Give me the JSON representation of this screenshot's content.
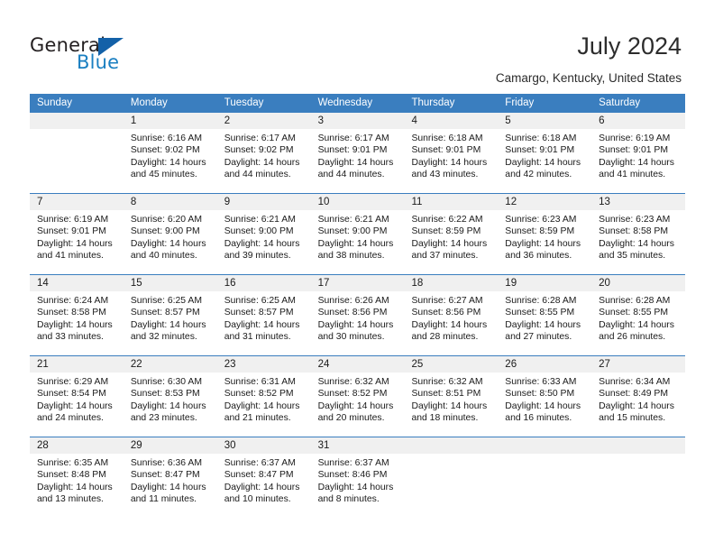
{
  "brand": {
    "name_top": "General",
    "name_bottom": "Blue",
    "triangle_color": "#1361a8",
    "blue_color": "#1a7fc1"
  },
  "header": {
    "title": "July 2024",
    "subtitle": "Camargo, Kentucky, United States",
    "header_bar_color": "#3a7ebf"
  },
  "weekdays": [
    "Sunday",
    "Monday",
    "Tuesday",
    "Wednesday",
    "Thursday",
    "Friday",
    "Saturday"
  ],
  "weeks": [
    [
      {
        "day": "",
        "lines": []
      },
      {
        "day": "1",
        "lines": [
          "Sunrise: 6:16 AM",
          "Sunset: 9:02 PM",
          "Daylight: 14 hours",
          "and 45 minutes."
        ]
      },
      {
        "day": "2",
        "lines": [
          "Sunrise: 6:17 AM",
          "Sunset: 9:02 PM",
          "Daylight: 14 hours",
          "and 44 minutes."
        ]
      },
      {
        "day": "3",
        "lines": [
          "Sunrise: 6:17 AM",
          "Sunset: 9:01 PM",
          "Daylight: 14 hours",
          "and 44 minutes."
        ]
      },
      {
        "day": "4",
        "lines": [
          "Sunrise: 6:18 AM",
          "Sunset: 9:01 PM",
          "Daylight: 14 hours",
          "and 43 minutes."
        ]
      },
      {
        "day": "5",
        "lines": [
          "Sunrise: 6:18 AM",
          "Sunset: 9:01 PM",
          "Daylight: 14 hours",
          "and 42 minutes."
        ]
      },
      {
        "day": "6",
        "lines": [
          "Sunrise: 6:19 AM",
          "Sunset: 9:01 PM",
          "Daylight: 14 hours",
          "and 41 minutes."
        ]
      }
    ],
    [
      {
        "day": "7",
        "lines": [
          "Sunrise: 6:19 AM",
          "Sunset: 9:01 PM",
          "Daylight: 14 hours",
          "and 41 minutes."
        ]
      },
      {
        "day": "8",
        "lines": [
          "Sunrise: 6:20 AM",
          "Sunset: 9:00 PM",
          "Daylight: 14 hours",
          "and 40 minutes."
        ]
      },
      {
        "day": "9",
        "lines": [
          "Sunrise: 6:21 AM",
          "Sunset: 9:00 PM",
          "Daylight: 14 hours",
          "and 39 minutes."
        ]
      },
      {
        "day": "10",
        "lines": [
          "Sunrise: 6:21 AM",
          "Sunset: 9:00 PM",
          "Daylight: 14 hours",
          "and 38 minutes."
        ]
      },
      {
        "day": "11",
        "lines": [
          "Sunrise: 6:22 AM",
          "Sunset: 8:59 PM",
          "Daylight: 14 hours",
          "and 37 minutes."
        ]
      },
      {
        "day": "12",
        "lines": [
          "Sunrise: 6:23 AM",
          "Sunset: 8:59 PM",
          "Daylight: 14 hours",
          "and 36 minutes."
        ]
      },
      {
        "day": "13",
        "lines": [
          "Sunrise: 6:23 AM",
          "Sunset: 8:58 PM",
          "Daylight: 14 hours",
          "and 35 minutes."
        ]
      }
    ],
    [
      {
        "day": "14",
        "lines": [
          "Sunrise: 6:24 AM",
          "Sunset: 8:58 PM",
          "Daylight: 14 hours",
          "and 33 minutes."
        ]
      },
      {
        "day": "15",
        "lines": [
          "Sunrise: 6:25 AM",
          "Sunset: 8:57 PM",
          "Daylight: 14 hours",
          "and 32 minutes."
        ]
      },
      {
        "day": "16",
        "lines": [
          "Sunrise: 6:25 AM",
          "Sunset: 8:57 PM",
          "Daylight: 14 hours",
          "and 31 minutes."
        ]
      },
      {
        "day": "17",
        "lines": [
          "Sunrise: 6:26 AM",
          "Sunset: 8:56 PM",
          "Daylight: 14 hours",
          "and 30 minutes."
        ]
      },
      {
        "day": "18",
        "lines": [
          "Sunrise: 6:27 AM",
          "Sunset: 8:56 PM",
          "Daylight: 14 hours",
          "and 28 minutes."
        ]
      },
      {
        "day": "19",
        "lines": [
          "Sunrise: 6:28 AM",
          "Sunset: 8:55 PM",
          "Daylight: 14 hours",
          "and 27 minutes."
        ]
      },
      {
        "day": "20",
        "lines": [
          "Sunrise: 6:28 AM",
          "Sunset: 8:55 PM",
          "Daylight: 14 hours",
          "and 26 minutes."
        ]
      }
    ],
    [
      {
        "day": "21",
        "lines": [
          "Sunrise: 6:29 AM",
          "Sunset: 8:54 PM",
          "Daylight: 14 hours",
          "and 24 minutes."
        ]
      },
      {
        "day": "22",
        "lines": [
          "Sunrise: 6:30 AM",
          "Sunset: 8:53 PM",
          "Daylight: 14 hours",
          "and 23 minutes."
        ]
      },
      {
        "day": "23",
        "lines": [
          "Sunrise: 6:31 AM",
          "Sunset: 8:52 PM",
          "Daylight: 14 hours",
          "and 21 minutes."
        ]
      },
      {
        "day": "24",
        "lines": [
          "Sunrise: 6:32 AM",
          "Sunset: 8:52 PM",
          "Daylight: 14 hours",
          "and 20 minutes."
        ]
      },
      {
        "day": "25",
        "lines": [
          "Sunrise: 6:32 AM",
          "Sunset: 8:51 PM",
          "Daylight: 14 hours",
          "and 18 minutes."
        ]
      },
      {
        "day": "26",
        "lines": [
          "Sunrise: 6:33 AM",
          "Sunset: 8:50 PM",
          "Daylight: 14 hours",
          "and 16 minutes."
        ]
      },
      {
        "day": "27",
        "lines": [
          "Sunrise: 6:34 AM",
          "Sunset: 8:49 PM",
          "Daylight: 14 hours",
          "and 15 minutes."
        ]
      }
    ],
    [
      {
        "day": "28",
        "lines": [
          "Sunrise: 6:35 AM",
          "Sunset: 8:48 PM",
          "Daylight: 14 hours",
          "and 13 minutes."
        ]
      },
      {
        "day": "29",
        "lines": [
          "Sunrise: 6:36 AM",
          "Sunset: 8:47 PM",
          "Daylight: 14 hours",
          "and 11 minutes."
        ]
      },
      {
        "day": "30",
        "lines": [
          "Sunrise: 6:37 AM",
          "Sunset: 8:47 PM",
          "Daylight: 14 hours",
          "and 10 minutes."
        ]
      },
      {
        "day": "31",
        "lines": [
          "Sunrise: 6:37 AM",
          "Sunset: 8:46 PM",
          "Daylight: 14 hours",
          "and 8 minutes."
        ]
      },
      {
        "day": "",
        "lines": []
      },
      {
        "day": "",
        "lines": []
      },
      {
        "day": "",
        "lines": []
      }
    ]
  ]
}
